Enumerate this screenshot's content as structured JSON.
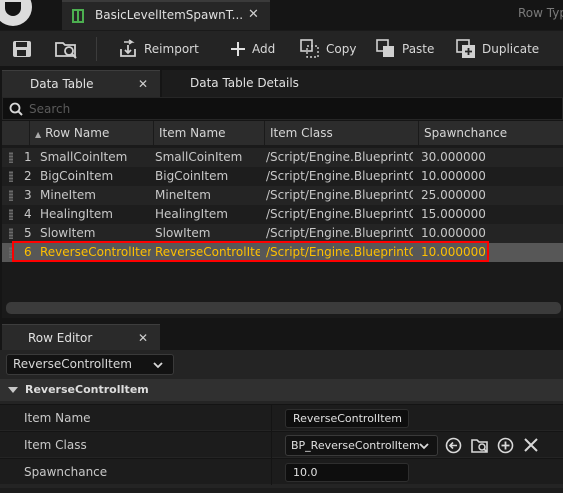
{
  "tab": {
    "title": "BasicLevelItemSpawnT...",
    "close": "✕"
  },
  "row_type_label": "Row Typ",
  "toolbar": {
    "reimport": "Reimport",
    "add": "Add",
    "copy": "Copy",
    "paste": "Paste",
    "duplicate": "Duplicate"
  },
  "panels": {
    "data_table": "Data Table",
    "data_table_details": "Data Table Details",
    "close": "✕"
  },
  "search": {
    "placeholder": "Search"
  },
  "table": {
    "headers": [
      "Row Name",
      "Item Name",
      "Item Class",
      "Spawnchance"
    ],
    "rows": [
      {
        "index": "1",
        "row_name": "SmallCoinItem",
        "item_name": "SmallCoinItem",
        "item_class": "/Script/Engine.BlueprintGen",
        "spawnchance": "30.000000"
      },
      {
        "index": "2",
        "row_name": "BigCoinItem",
        "item_name": "BigCoinItem",
        "item_class": "/Script/Engine.BlueprintGen",
        "spawnchance": "10.000000"
      },
      {
        "index": "3",
        "row_name": "MineItem",
        "item_name": "MineItem",
        "item_class": "/Script/Engine.BlueprintGen",
        "spawnchance": "25.000000"
      },
      {
        "index": "4",
        "row_name": "HealingItem",
        "item_name": "HealingItem",
        "item_class": "/Script/Engine.BlueprintGen",
        "spawnchance": "15.000000"
      },
      {
        "index": "5",
        "row_name": "SlowItem",
        "item_name": "SlowItem",
        "item_class": "/Script/Engine.BlueprintGen",
        "spawnchance": "10.000000"
      },
      {
        "index": "6",
        "row_name": "ReverseControlItem",
        "item_name": "ReverseControlItem",
        "item_class": "/Script/Engine.BlueprintGen",
        "spawnchance": "10.000000"
      }
    ],
    "selected_index": "6"
  },
  "row_editor": {
    "tab": "Row Editor",
    "close": "✕",
    "selected_row": "ReverseControlItem",
    "category": "ReverseControlItem",
    "properties": {
      "item_name_label": "Item Name",
      "item_name_value": "ReverseControlItem",
      "item_class_label": "Item Class",
      "item_class_value": "BP_ReverseControlItem",
      "spawnchance_label": "Spawnchance",
      "spawnchance_value": "10.0"
    }
  },
  "colors": {
    "selected_text": "#ffc000",
    "selection_outline": "#ff0000",
    "table_icon": "#4caf50"
  }
}
